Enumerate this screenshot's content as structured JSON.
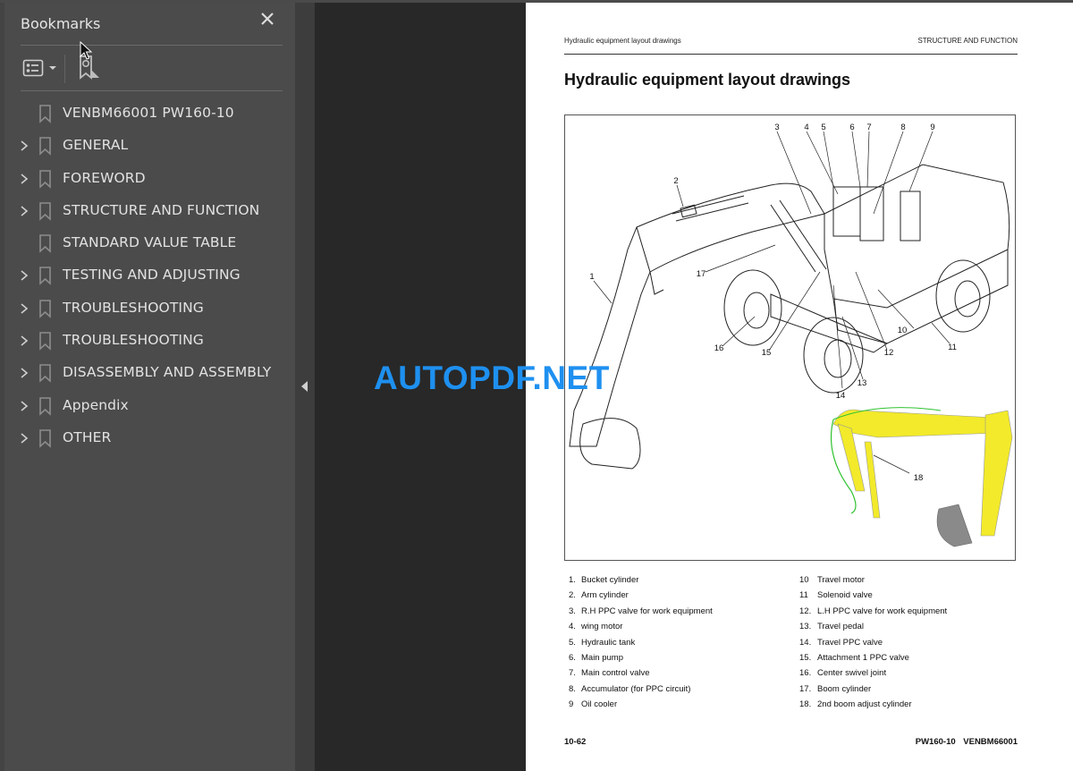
{
  "sidebar": {
    "title": "Bookmarks",
    "close_icon": "close-icon",
    "toolbar": {
      "options_icon": "list-options-icon",
      "bookmark_tool_icon": "bookmark-add-icon"
    },
    "items": [
      {
        "label": "VENBM66001 PW160-10",
        "expandable": false
      },
      {
        "label": "GENERAL",
        "expandable": true
      },
      {
        "label": "FOREWORD",
        "expandable": true
      },
      {
        "label": "STRUCTURE AND FUNCTION",
        "expandable": true
      },
      {
        "label": "STANDARD VALUE TABLE",
        "expandable": false
      },
      {
        "label": "TESTING AND ADJUSTING",
        "expandable": true
      },
      {
        "label": "TROUBLESHOOTING",
        "expandable": true
      },
      {
        "label": "TROUBLESHOOTING",
        "expandable": true
      },
      {
        "label": "DISASSEMBLY AND ASSEMBLY",
        "expandable": true
      },
      {
        "label": "Appendix",
        "expandable": true
      },
      {
        "label": "OTHER",
        "expandable": true
      }
    ]
  },
  "page": {
    "header_left": "Hydraulic equipment layout drawings",
    "header_right": "STRUCTURE AND FUNCTION",
    "title": "Hydraulic equipment layout drawings",
    "callouts": [
      "1",
      "2",
      "3",
      "4",
      "5",
      "6",
      "7",
      "8",
      "9",
      "10",
      "11",
      "12",
      "13",
      "14",
      "15",
      "16",
      "17",
      "18"
    ],
    "legend_left": [
      {
        "num": "1.",
        "text": "Bucket cylinder"
      },
      {
        "num": "2.",
        "text": "Arm cylinder"
      },
      {
        "num": "3.",
        "text": "R.H PPC valve for work equipment"
      },
      {
        "num": "4.",
        "text": "wing motor"
      },
      {
        "num": "5.",
        "text": "Hydraulic tank"
      },
      {
        "num": "6.",
        "text": "Main pump"
      },
      {
        "num": "7.",
        "text": "Main control valve"
      },
      {
        "num": "8.",
        "text": "Accumulator (for PPC circuit)"
      },
      {
        "num": "9",
        "text": "Oil cooler"
      }
    ],
    "legend_right": [
      {
        "num": "10",
        "text": "Travel motor"
      },
      {
        "num": "11",
        "text": "Solenoid valve"
      },
      {
        "num": "12.",
        "text": "L.H PPC valve for work equipment"
      },
      {
        "num": "13.",
        "text": "Travel pedal"
      },
      {
        "num": "14.",
        "text": "Travel PPC valve"
      },
      {
        "num": "15.",
        "text": "Attachment 1 PPC valve"
      },
      {
        "num": "16.",
        "text": "Center swivel joint"
      },
      {
        "num": "17.",
        "text": "Boom cylinder"
      },
      {
        "num": "18.",
        "text": "2nd boom adjust cylinder"
      }
    ],
    "footer_left": "10-62",
    "footer_right": "PW160-10 VENBM66001"
  },
  "watermark": "AUTOPDF.NET",
  "colors": {
    "sidebar_bg": "#4b4b4b",
    "doc_bg": "#282828",
    "watermark": "#1e90f0",
    "boom_yellow": "#f2ea2a"
  }
}
